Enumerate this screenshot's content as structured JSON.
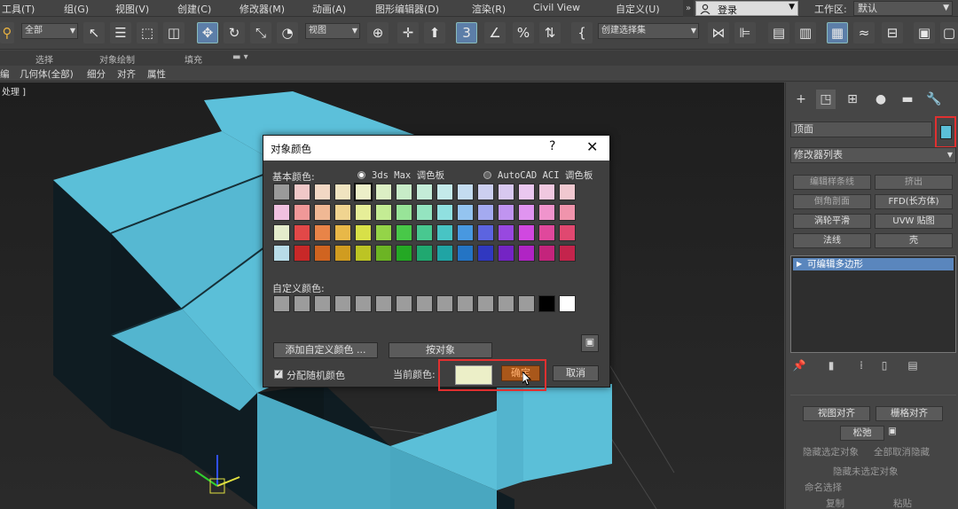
{
  "menubar": {
    "items": [
      "工具(T)",
      "组(G)",
      "视图(V)",
      "创建(C)",
      "修改器(M)",
      "动画(A)",
      "图形编辑器(D)",
      "渲染(R)",
      "Civil View",
      "自定义(U)"
    ],
    "overflow": "»",
    "login": "登录",
    "workspace_label": "工作区:",
    "workspace_value": "默认"
  },
  "toolbar": {
    "filter_value": "全部",
    "refcoord_value": "视图",
    "selset_value": "创建选择集"
  },
  "ribbon": {
    "labels": [
      "选择",
      "对象绘制",
      "填充"
    ]
  },
  "row3": {
    "items": [
      "编",
      "几何体(全部)",
      "细分",
      "对齐",
      "属性"
    ]
  },
  "viewport": {
    "label": "处理 ]"
  },
  "cmdpanel": {
    "object_name": "顶面",
    "object_color": "#5bbfd8",
    "modifier_list": "修改器列表",
    "mod_buttons": [
      "编辑样条线",
      "挤出",
      "倒角剖面",
      "FFD(长方体)",
      "涡轮平滑",
      "UVW 贴图",
      "法线",
      "壳"
    ],
    "stack_item": "可编辑多边形",
    "rollout": {
      "view_align": "视图对齐",
      "grid_align": "栅格对齐",
      "relax": "松弛",
      "hide_selected": "隐藏选定对象",
      "unhide_all": "全部取消隐藏",
      "hide_unselected": "隐藏未选定对象",
      "named_selection": "命名选择",
      "copy": "复制",
      "paste": "粘贴"
    }
  },
  "dialog": {
    "title": "对象颜色",
    "help": "?",
    "close": "✕",
    "basic_colors": "基本颜色:",
    "palette_max": "3ds Max 调色板",
    "palette_acad": "AutoCAD ACI 调色板",
    "custom_colors": "自定义颜色:",
    "add_custom": "添加自定义颜色 ...",
    "by_object": "按对象",
    "random_colors": "分配随机颜色",
    "current_color": "当前颜色:",
    "current_color_value": "#ecefc8",
    "ok": "确定",
    "cancel": "取消",
    "palette_rows": [
      [
        "#9a9a9a",
        "#f0c8c8",
        "#f2d8c4",
        "#f0e4c0",
        "#ecefc8",
        "#dcefc4",
        "#c8ecc8",
        "#c4ecd8",
        "#c4eaea",
        "#c4dcf0",
        "#cccff0",
        "#d8c8f0",
        "#eac8f0",
        "#f0c8e0",
        "#f0c8d0"
      ],
      [
        "#f0c0e0",
        "#f09898",
        "#f0b894",
        "#f0d490",
        "#e6ee98",
        "#c4ec94",
        "#98e498",
        "#94e4c0",
        "#90e0e0",
        "#94c4f0",
        "#a4aaf0",
        "#c094f0",
        "#e094f0",
        "#f094cc",
        "#f094ac"
      ],
      [
        "#e4eccc",
        "#e24848",
        "#e88448",
        "#e8b848",
        "#d8e048",
        "#94d448",
        "#48c848",
        "#48c890",
        "#48c4c4",
        "#4898e0",
        "#5c64e0",
        "#9848e0",
        "#d048e0",
        "#e0489c",
        "#e04870"
      ],
      [
        "#b8dce8",
        "#c82828",
        "#d06420",
        "#d09c20",
        "#bcc424",
        "#6cb424",
        "#24a824",
        "#20a870",
        "#20a4a4",
        "#2474c4",
        "#3038c0",
        "#7424c4",
        "#b024c4",
        "#c4247c",
        "#c4244c"
      ]
    ],
    "custom_row": [
      "#9c9c9c",
      "#9c9c9c",
      "#9c9c9c",
      "#9c9c9c",
      "#9c9c9c",
      "#9c9c9c",
      "#9c9c9c",
      "#9c9c9c",
      "#9c9c9c",
      "#9c9c9c",
      "#9c9c9c",
      "#9c9c9c",
      "#9c9c9c",
      "#000000",
      "#ffffff"
    ]
  }
}
